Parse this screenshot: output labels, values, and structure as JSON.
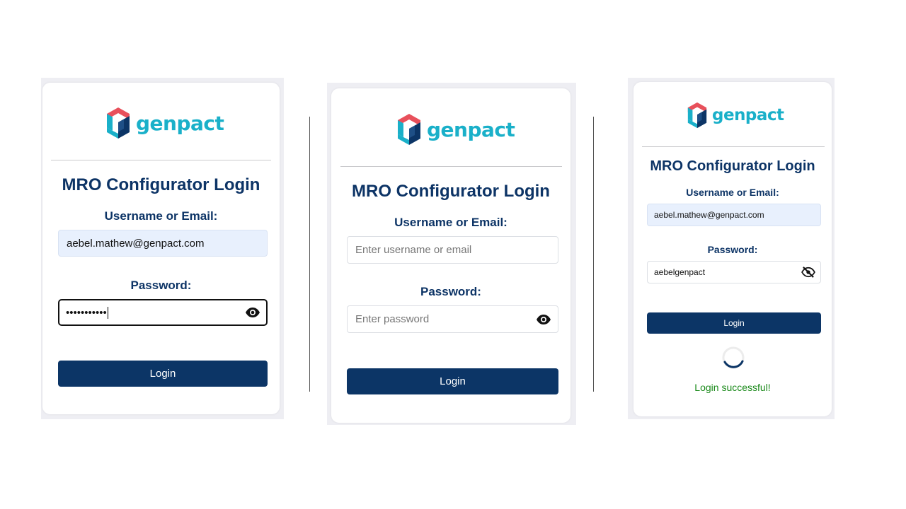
{
  "brand": {
    "logo_text": "genpact",
    "logo_icon": "genpact-hexagon-logo-icon",
    "colors": {
      "teal": "#1ab0c9",
      "navy": "#0c3566",
      "red": "#e8505b",
      "success": "#1b8a1b"
    }
  },
  "panels": [
    {
      "title": "MRO Configurator Login",
      "username_label": "Username or Email:",
      "username_value": "aebel.mathew@genpact.com",
      "username_placeholder": "Enter username or email",
      "password_label": "Password:",
      "password_value": "•••••••••••",
      "password_placeholder": "Enter password",
      "password_toggle_icon": "eye-icon",
      "login_label": "Login"
    },
    {
      "title": "MRO Configurator Login",
      "username_label": "Username or Email:",
      "username_value": "",
      "username_placeholder": "Enter username or email",
      "password_label": "Password:",
      "password_value": "",
      "password_placeholder": "Enter password",
      "password_toggle_icon": "eye-icon",
      "login_label": "Login"
    },
    {
      "title": "MRO Configurator Login",
      "username_label": "Username or Email:",
      "username_value": "aebel.mathew@genpact.com",
      "username_placeholder": "Enter username or email",
      "password_label": "Password:",
      "password_value": "aebelgenpact",
      "password_placeholder": "Enter password",
      "password_toggle_icon": "eye-slash-icon",
      "login_label": "Login",
      "loading_icon": "spinner-icon",
      "status_message": "Login successful!"
    }
  ]
}
